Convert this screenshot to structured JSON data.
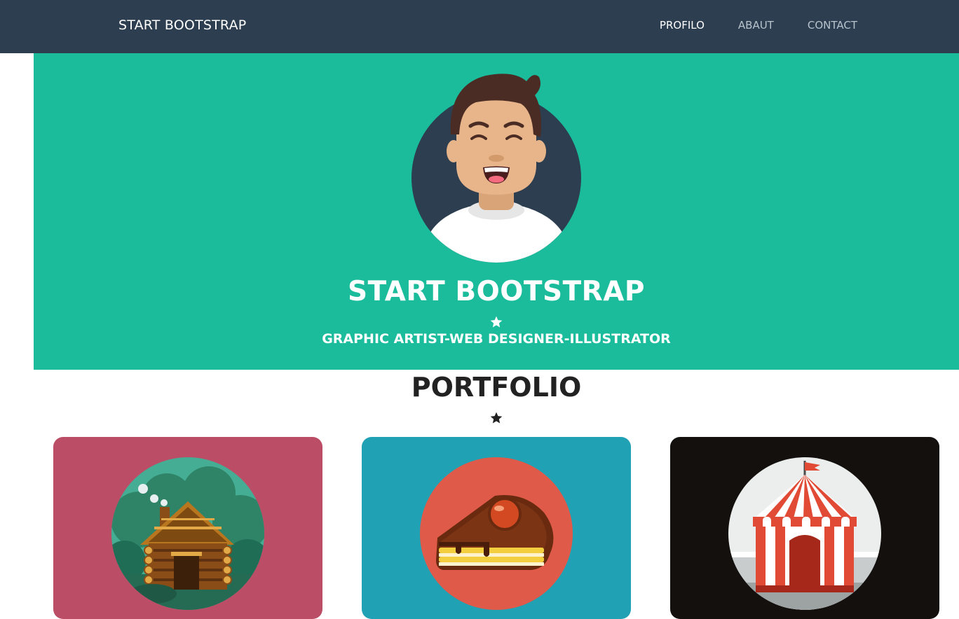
{
  "navbar": {
    "brand": "START BOOTSTRAP",
    "links": [
      {
        "label": "PROFILO",
        "active": true
      },
      {
        "label": "ABAUT",
        "active": false
      },
      {
        "label": "CONTACT",
        "active": false
      }
    ]
  },
  "hero": {
    "title": "START BOOTSTRAP",
    "subtitle": "GRAPHIC ARTIST-WEB DESIGNER-ILLUSTRATOR",
    "star_icon": "star-icon"
  },
  "portfolio": {
    "title": "PORTFOLIO",
    "star_icon": "star-icon",
    "items": [
      {
        "icon": "cabin-icon",
        "color": "#bb4d67"
      },
      {
        "icon": "cake-icon",
        "color": "#21a1b4"
      },
      {
        "icon": "circus-tent-icon",
        "color": "#13100e"
      }
    ]
  },
  "colors": {
    "navbar": "#2c3e50",
    "hero": "#1abc9c",
    "text_dark": "#222222"
  }
}
